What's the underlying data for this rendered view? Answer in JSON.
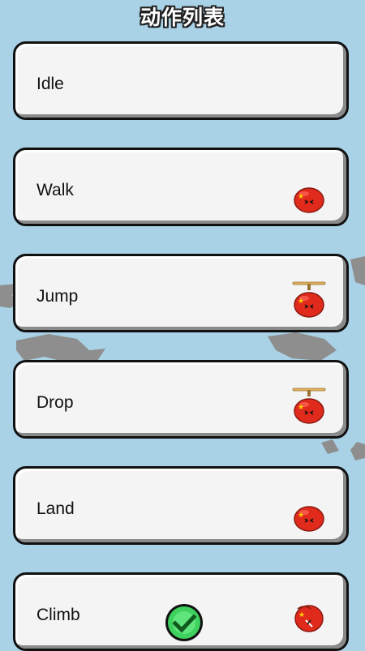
{
  "header": {
    "title": "动作列表"
  },
  "actions": [
    {
      "label": "Idle",
      "pet": "none"
    },
    {
      "label": "Walk",
      "pet": "pet-ball-icon"
    },
    {
      "label": "Jump",
      "pet": "pet-propeller-icon"
    },
    {
      "label": "Drop",
      "pet": "pet-propeller-icon"
    },
    {
      "label": "Land",
      "pet": "pet-ball-icon"
    },
    {
      "label": "Climb",
      "pet": "pet-climb-icon",
      "selected": true
    }
  ],
  "colors": {
    "background": "#a9d2e6",
    "card": "#f4f4f5",
    "pet": "#e02a1c",
    "check": "#3ed15e"
  }
}
